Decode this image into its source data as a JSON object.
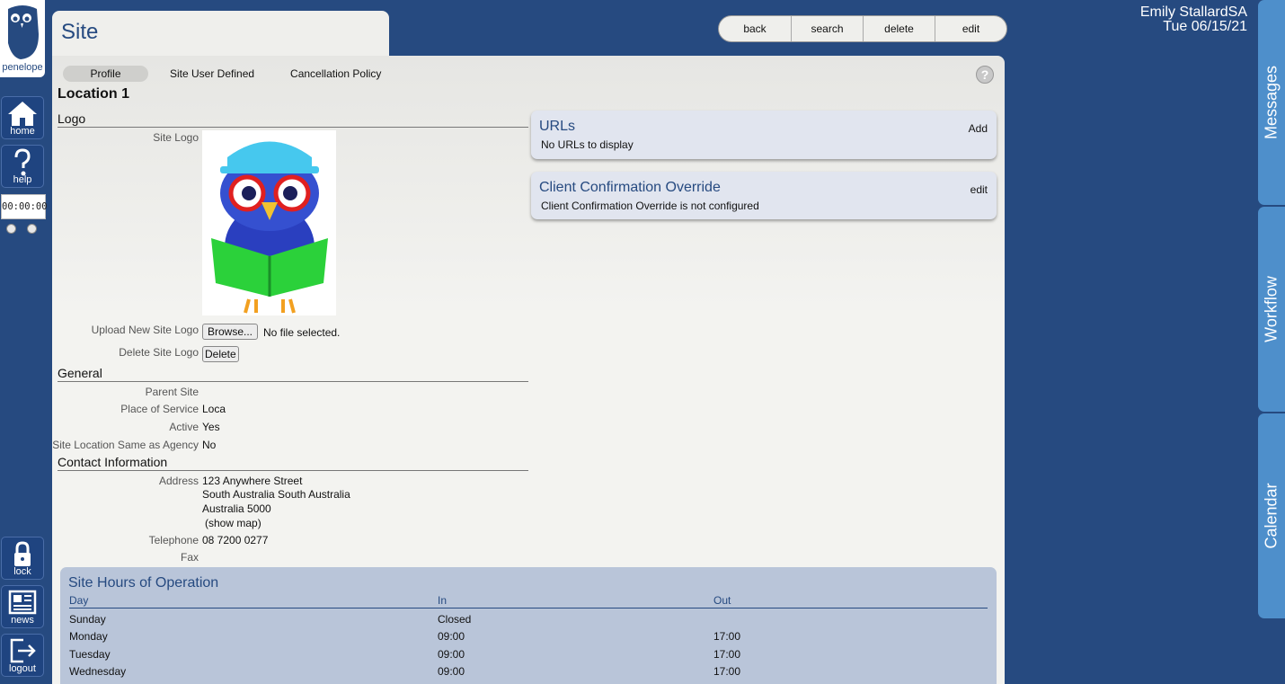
{
  "app": {
    "logo_text": "penelope"
  },
  "nav": {
    "home": "home",
    "help": "help",
    "timer": "00:00:00",
    "lock": "lock",
    "news": "news",
    "logout": "logout"
  },
  "side_tabs": {
    "messages": "Messages",
    "workflow": "Workflow",
    "calendar": "Calendar"
  },
  "header": {
    "user": "Emily StallardSA",
    "date": "Tue 06/15/21",
    "page_title": "Site",
    "actions": {
      "back": "back",
      "search": "search",
      "delete": "delete",
      "edit": "edit"
    }
  },
  "tabs": [
    {
      "label": "Profile",
      "active": true
    },
    {
      "label": "Site User Defined"
    },
    {
      "label": "Cancellation Policy"
    }
  ],
  "help_icon": "?",
  "location_title": "Location 1",
  "logo_section": {
    "heading": "Logo",
    "site_logo_label": "Site Logo",
    "upload_label": "Upload New Site Logo",
    "browse_button": "Browse...",
    "no_file": "No file selected.",
    "delete_label": "Delete Site Logo",
    "delete_button": "Delete"
  },
  "general": {
    "heading": "General",
    "fields": [
      {
        "label": "Parent Site",
        "value": ""
      },
      {
        "label": "Place of Service",
        "value": "Loca"
      },
      {
        "label": "Active",
        "value": "Yes"
      },
      {
        "label": "Site Location Same as Agency",
        "value": "No"
      }
    ]
  },
  "contact": {
    "heading": "Contact Information",
    "address_label": "Address",
    "address_lines": [
      "123 Anywhere Street",
      "South Australia South Australia",
      "Australia 5000"
    ],
    "show_map": "(show map)",
    "telephone_label": "Telephone",
    "telephone": "08 7200 0277",
    "fax_label": "Fax",
    "fax": ""
  },
  "urls": {
    "title": "URLs",
    "action": "Add",
    "message": "No URLs to display"
  },
  "override": {
    "title": "Client Confirmation Override",
    "action": "edit",
    "message": "Client Confirmation Override is not configured"
  },
  "hours": {
    "title": "Site Hours of Operation",
    "columns": [
      "Day",
      "In",
      "Out"
    ],
    "rows": [
      {
        "day": "Sunday",
        "in": "Closed",
        "out": ""
      },
      {
        "day": "Monday",
        "in": "09:00",
        "out": "17:00"
      },
      {
        "day": "Tuesday",
        "in": "09:00",
        "out": "17:00"
      },
      {
        "day": "Wednesday",
        "in": "09:00",
        "out": "17:00"
      }
    ]
  },
  "colors": {
    "brand": "#264a80",
    "side_tab": "#4e8fcb",
    "panel": "#f3f3f0",
    "card": "#e1e5ef",
    "hours_panel": "#b9c5d9"
  }
}
